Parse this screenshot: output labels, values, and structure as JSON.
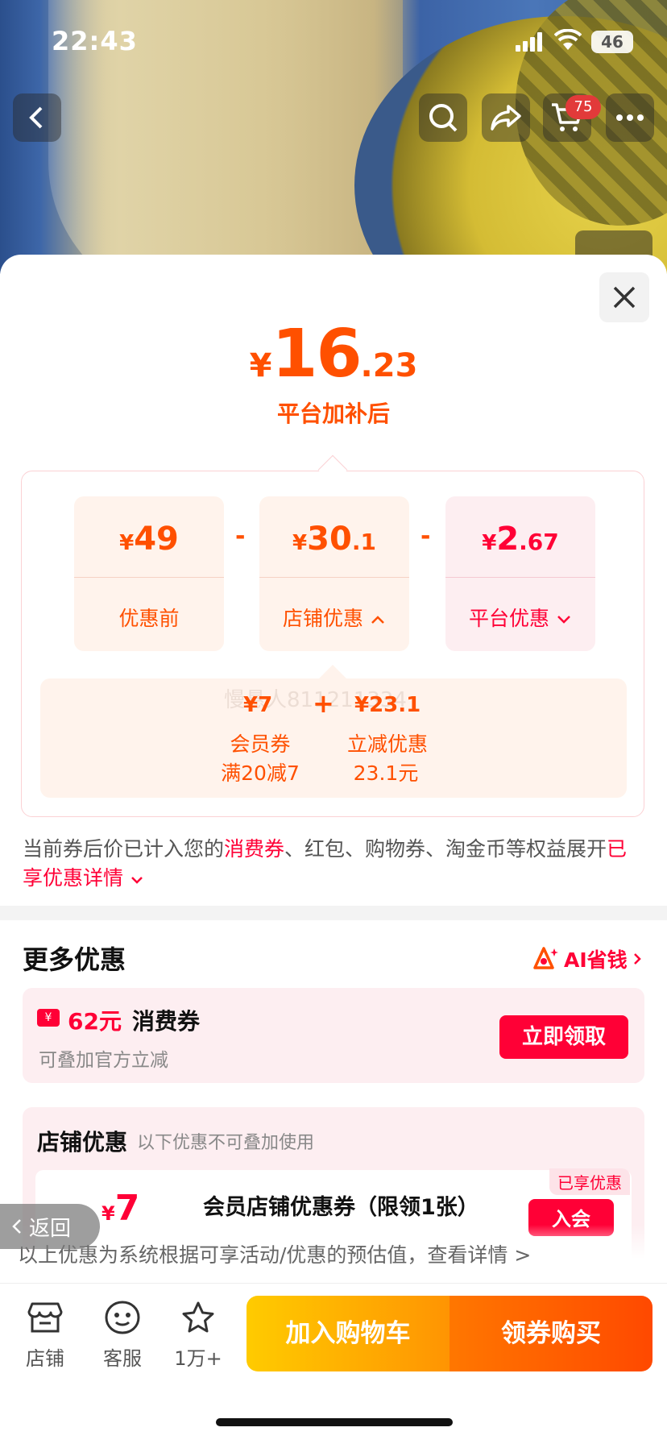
{
  "status_bar": {
    "time": "22:43",
    "battery": "46"
  },
  "top_nav": {
    "cart_count": "75"
  },
  "price": {
    "currency": "¥",
    "integer": "16",
    "decimal": ".23",
    "subtitle": "平台加补后"
  },
  "breakdown": {
    "cards": [
      {
        "currency": "¥",
        "integer": "49",
        "decimal": "",
        "label": "优惠前"
      },
      {
        "currency": "¥",
        "integer": "30",
        "decimal": ".1",
        "label": "店铺优惠"
      },
      {
        "currency": "¥",
        "integer": "2",
        "decimal": ".67",
        "label": "平台优惠"
      }
    ],
    "operators": [
      "-",
      "-"
    ],
    "store_detail": {
      "items": [
        {
          "value": "¥7",
          "label": "会员券",
          "note": "满20减7"
        },
        {
          "value": "¥23.1",
          "label": "立减优惠",
          "note": "23.1元"
        }
      ],
      "plus": "+",
      "watermark": "慢悬人811211334"
    }
  },
  "note": {
    "part1": "当前券后价已计入您的",
    "highlight": "消费券",
    "part2": "、红包、购物券、淘金币等权益展开",
    "link": "已享优惠详情"
  },
  "more_offers": {
    "title": "更多优惠",
    "ai_label": "AI省钱",
    "coupon": {
      "icon_text": "¥",
      "amount": "62元",
      "name": "消费券",
      "desc": "可叠加官方立减",
      "button": "立即领取"
    },
    "shop": {
      "title": "店铺优惠",
      "subtitle": "以下优惠不可叠加使用",
      "item": {
        "currency": "¥",
        "amount": "7",
        "name": "会员店铺优惠券（限领1张）",
        "tag": "已享优惠",
        "button": "入会"
      }
    }
  },
  "disclaimer": "以上优惠为系统根据可享活动/优惠的预估值，查看详情 >",
  "back_button": "返回",
  "bottom_bar": {
    "shop": "店铺",
    "service": "客服",
    "favorites": "1万+",
    "add_cart": "加入购物车",
    "buy": "领券购买"
  },
  "colors": {
    "orange": "#ff5000",
    "red": "#ff0036"
  }
}
